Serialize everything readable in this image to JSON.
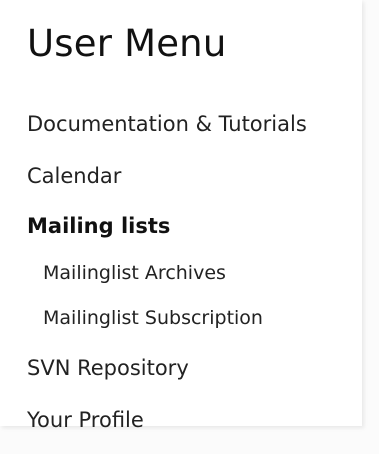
{
  "user_menu": {
    "title": "User Menu",
    "items": [
      {
        "label": "Documentation & Tutorials"
      },
      {
        "label": "Calendar"
      },
      {
        "label": "Mailing lists"
      },
      {
        "label": "Mailinglist Archives"
      },
      {
        "label": "Mailinglist Subscription"
      },
      {
        "label": "SVN Repository"
      },
      {
        "label": "Your Profile"
      }
    ]
  }
}
